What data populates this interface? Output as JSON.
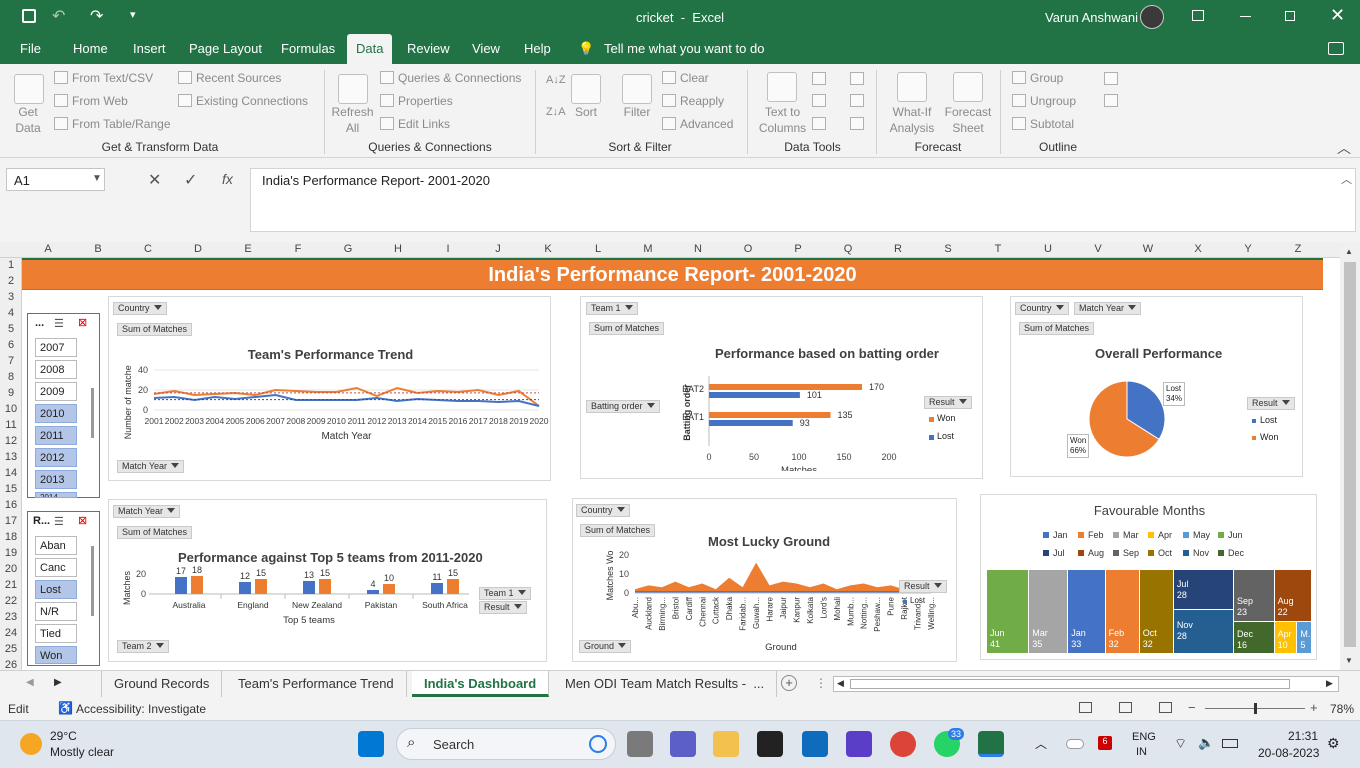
{
  "window": {
    "title": "cricket  -  Excel",
    "user": "Varun Anshwani"
  },
  "menu": [
    "File",
    "Home",
    "Insert",
    "Page Layout",
    "Formulas",
    "Data",
    "Review",
    "View",
    "Help"
  ],
  "tell_me": "Tell me what you want to do",
  "ribbon": {
    "get_data": "Get\nData",
    "from_text_csv": "From Text/CSV",
    "from_web": "From Web",
    "from_table": "From Table/Range",
    "recent_sources": "Recent Sources",
    "existing_connections": "Existing Connections",
    "group_get_transform": "Get & Transform Data",
    "refresh_all": "Refresh\nAll",
    "queries_connections": "Queries & Connections",
    "properties": "Properties",
    "edit_links": "Edit Links",
    "group_queries": "Queries & Connections",
    "sort": "Sort",
    "filter": "Filter",
    "clear": "Clear",
    "reapply": "Reapply",
    "advanced": "Advanced",
    "group_sort_filter": "Sort & Filter",
    "text_to_columns": "Text to\nColumns",
    "group_data_tools": "Data Tools",
    "what_if": "What-If\nAnalysis",
    "forecast_sheet": "Forecast\nSheet",
    "group_forecast": "Forecast",
    "group_btn": "Group",
    "ungroup_btn": "Ungroup",
    "subtotal": "Subtotal",
    "group_outline": "Outline"
  },
  "formula_bar": {
    "cell_ref": "A1",
    "content": "India's Performance Report- 2001-2020"
  },
  "columns": [
    "A",
    "B",
    "C",
    "D",
    "E",
    "F",
    "G",
    "H",
    "I",
    "J",
    "K",
    "L",
    "M",
    "N",
    "O",
    "P",
    "Q",
    "R",
    "S",
    "T",
    "U",
    "V",
    "W",
    "X",
    "Y",
    "Z"
  ],
  "rows": [
    "1",
    "2",
    "3",
    "4",
    "5",
    "6",
    "7",
    "8",
    "9",
    "10",
    "11",
    "12",
    "13",
    "14",
    "15",
    "16",
    "17",
    "18",
    "19",
    "20",
    "21",
    "22",
    "23",
    "24",
    "25",
    "26"
  ],
  "banner_title": "India's Performance Report- 2001-2020",
  "slicer_year": {
    "header": "...",
    "items": [
      "2007",
      "2008",
      "2009",
      "2010",
      "2011",
      "2012",
      "2013",
      "2014"
    ],
    "selected": [
      "2010",
      "2011",
      "2012",
      "2013",
      "2014"
    ]
  },
  "slicer_result": {
    "header": "R...",
    "items": [
      "Aban",
      "Canc",
      "Lost",
      "N/R",
      "Tied",
      "Won"
    ],
    "selected": [
      "Lost",
      "Won"
    ]
  },
  "pivot_buttons": {
    "country": "Country",
    "sum_matches": "Sum of Matches",
    "match_year": "Match Year",
    "team1": "Team 1",
    "batting_order": "Batting order",
    "result": "Result",
    "team2": "Team 2",
    "ground": "Ground"
  },
  "colors": {
    "won": "#ed7d31",
    "lost": "#4472c4",
    "excel_green": "#217346",
    "banner": "#ed7d31"
  },
  "chart_data": [
    {
      "type": "line",
      "title": "Team's Performance Trend",
      "xlabel": "Match Year",
      "ylabel": "Number of matches",
      "ylim": [
        0,
        40
      ],
      "x": [
        "2001",
        "2002",
        "2003",
        "2004",
        "2005",
        "2006",
        "2007",
        "2008",
        "2009",
        "2010",
        "2011",
        "2012",
        "2013",
        "2014",
        "2015",
        "2016",
        "2017",
        "2018",
        "2019",
        "2020"
      ],
      "series": [
        {
          "name": "Won",
          "values": [
            16,
            19,
            15,
            16,
            17,
            15,
            20,
            19,
            18,
            18,
            22,
            14,
            22,
            17,
            19,
            18,
            20,
            15,
            19,
            4
          ]
        },
        {
          "name": "Lost",
          "values": [
            12,
            13,
            10,
            13,
            11,
            13,
            15,
            10,
            10,
            10,
            10,
            12,
            9,
            11,
            10,
            9,
            9,
            8,
            9,
            4
          ]
        }
      ],
      "trendline": true
    },
    {
      "type": "bar",
      "title": "Performance based on batting order",
      "xlabel": "Matches",
      "ylabel": "Batting order",
      "xlim": [
        0,
        200
      ],
      "xticks": [
        "0",
        "50",
        "100",
        "150",
        "200"
      ],
      "categories": [
        "BAT2",
        "BAT1"
      ],
      "legend_title": "Result",
      "series": [
        {
          "name": "Won",
          "values": [
            170,
            135
          ]
        },
        {
          "name": "Lost",
          "values": [
            101,
            93
          ]
        }
      ]
    },
    {
      "type": "pie",
      "title": "Overall Performance",
      "legend_title": "Result",
      "slices": [
        {
          "name": "Lost",
          "value": 34,
          "label": "Lost\n34%"
        },
        {
          "name": "Won",
          "value": 66,
          "label": "Won\n66%"
        }
      ]
    },
    {
      "type": "bar",
      "title": "Performance against Top 5 teams from 2011-2020",
      "xlabel": "Top 5 teams",
      "ylabel": "Matches",
      "ylim": [
        0,
        20
      ],
      "yticks": [
        "0",
        "20"
      ],
      "categories": [
        "Australia",
        "England",
        "New Zealand",
        "Pakistan",
        "South Africa"
      ],
      "series": [
        {
          "name": "Lost",
          "values": [
            17,
            12,
            13,
            4,
            11
          ]
        },
        {
          "name": "Won",
          "values": [
            18,
            15,
            15,
            10,
            15
          ]
        }
      ]
    },
    {
      "type": "area",
      "title": "Most Lucky Ground",
      "xlabel": "Ground",
      "ylabel": "Matches Won",
      "ylim": [
        0,
        20
      ],
      "yticks": [
        "0",
        "10",
        "20"
      ],
      "categories": [
        "Abu...",
        "Auckland",
        "Birming...",
        "Bristol",
        "Cardiff",
        "Chennai",
        "Cuttack",
        "Dhaka",
        "Faridab...",
        "Guwah...",
        "Harare",
        "Jaipur",
        "Kanpur",
        "Kolkata",
        "Lord's",
        "Mohali",
        "Mumb...",
        "Notting...",
        "Peshaw...",
        "Pune",
        "Rajkot",
        "Trivand...",
        "Welling..."
      ],
      "series": [
        {
          "name": "Won",
          "values": [
            2,
            4,
            3,
            6,
            3,
            5,
            2,
            8,
            3,
            16,
            4,
            6,
            5,
            3,
            5,
            2,
            4,
            5,
            3,
            4,
            2,
            3,
            2
          ]
        },
        {
          "name": "Lost",
          "values": [
            1,
            1,
            1,
            1,
            1,
            1,
            1,
            1,
            1,
            1,
            1,
            1,
            1,
            1,
            1,
            1,
            1,
            1,
            1,
            1,
            1,
            1,
            1
          ]
        }
      ],
      "legend_title": "Result",
      "legend_items": [
        "Lost"
      ]
    },
    {
      "type": "heatmap",
      "title": "Favourable Months",
      "legend": [
        "Jan",
        "Feb",
        "Mar",
        "Apr",
        "May",
        "Jun",
        "Jul",
        "Aug",
        "Sep",
        "Oct",
        "Nov",
        "Dec"
      ],
      "legend_colors": [
        "#4472c4",
        "#ed7d31",
        "#a5a5a5",
        "#ffc000",
        "#5b9bd5",
        "#70ad47",
        "#264478",
        "#9e480e",
        "#636363",
        "#997300",
        "#255e91",
        "#43682b"
      ],
      "cells": [
        {
          "name": "Jun",
          "value": "41"
        },
        {
          "name": "Mar",
          "value": "35"
        },
        {
          "name": "Jan",
          "value": "33"
        },
        {
          "name": "Feb",
          "value": "32"
        },
        {
          "name": "Oct",
          "value": "32"
        },
        {
          "name": "Jul",
          "value": "28"
        },
        {
          "name": "Nov",
          "value": "28"
        },
        {
          "name": "Sep",
          "value": "23"
        },
        {
          "name": "Aug",
          "value": "22"
        },
        {
          "name": "Dec",
          "value": "16"
        },
        {
          "name": "Apr",
          "value": "10"
        },
        {
          "name": "M...",
          "value": "5"
        }
      ]
    }
  ],
  "sheet_tabs": [
    "Ground Records",
    "Team's Performance Trend",
    "India's Dashboard",
    "Men ODI Team Match Results -  ..."
  ],
  "active_tab": "India's Dashboard",
  "status": {
    "mode": "Edit",
    "accessibility": "Accessibility: Investigate",
    "zoom": "78%"
  },
  "taskbar": {
    "weather_temp": "29°C",
    "weather_desc": "Mostly clear",
    "search": "Search",
    "lang1": "ENG",
    "lang2": "IN",
    "time": "21:31",
    "date": "20-08-2023",
    "whatsapp_badge": "33",
    "notif_badge": "6"
  }
}
